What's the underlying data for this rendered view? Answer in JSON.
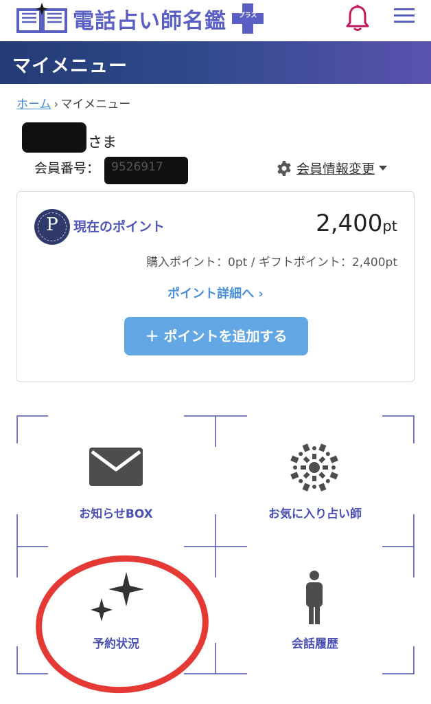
{
  "header": {
    "logo_text": "電話占い師名鑑",
    "logo_plus_text": "プラス",
    "colors": {
      "brand": "#5a5fc4",
      "bell": "#c2185b",
      "menu": "#5a5fc4"
    },
    "icons": [
      "open-book-icon",
      "plus-icon",
      "bell-icon",
      "hamburger-menu-icon"
    ]
  },
  "banner": {
    "title": "マイメニュー"
  },
  "breadcrumb": {
    "home": "ホーム",
    "separator": "›",
    "current": "マイメニュー"
  },
  "user": {
    "name_suffix": "さま",
    "member_label": "会員番号：",
    "member_number": "9526917",
    "settings_label": "会員情報変更"
  },
  "points": {
    "badge_letter": "P",
    "label": "現在のポイント",
    "value": "2,400",
    "unit": "pt",
    "breakdown": "購入ポイント：0pt / ギフトポイント：2,400pt",
    "detail_link": "ポイント詳細へ ›",
    "add_button": "＋ ポイントを追加する"
  },
  "menu": [
    {
      "label": "お知らせBOX",
      "icon": "envelope-icon"
    },
    {
      "label": "お気に入り占い師",
      "icon": "mandala-icon"
    },
    {
      "label": "予約状況",
      "icon": "sparkle-icon"
    },
    {
      "label": "会話履歴",
      "icon": "person-icon"
    }
  ],
  "accent_colors": {
    "primary_button": "#62a7e3",
    "link": "#3e8bd6",
    "menu_label": "#4b50b4",
    "annotation": "#e53935"
  }
}
